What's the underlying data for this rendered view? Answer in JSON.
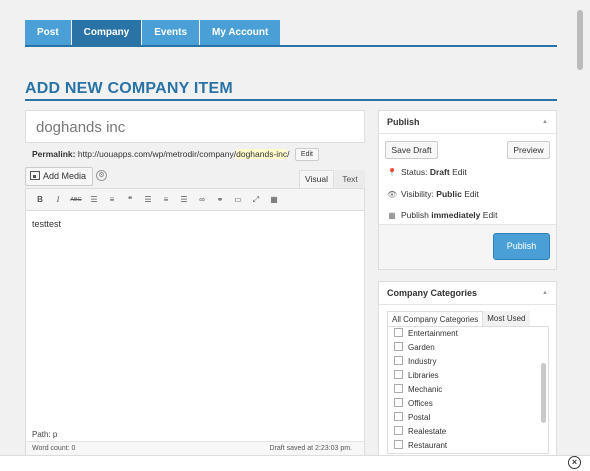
{
  "tabs": [
    {
      "label": "Post",
      "active": false
    },
    {
      "label": "Company",
      "active": true
    },
    {
      "label": "Events",
      "active": false
    },
    {
      "label": "My Account",
      "active": false
    }
  ],
  "page_title": "ADD NEW COMPANY ITEM",
  "editor": {
    "title_value": "doghands inc",
    "permalink_label": "Permalink:",
    "permalink_base": "http://uouapps.com/wp/metrodir/company/",
    "permalink_slug": "doghands-inc",
    "permalink_trailing": "/",
    "edit_label": "Edit",
    "add_media_label": "Add Media",
    "visual_tab": "Visual",
    "text_tab": "Text",
    "toolbar_bold": "B",
    "toolbar_italic": "I",
    "toolbar_strike": "ABC",
    "content": "testtest",
    "path_text": "Path: p",
    "word_count": "Word count: 0",
    "draft_saved": "Draft saved at 2:23:03 pm."
  },
  "publish": {
    "title": "Publish",
    "save_draft": "Save Draft",
    "preview": "Preview",
    "status_label": "Status:",
    "status_value": "Draft",
    "visibility_label": "Visibility:",
    "visibility_value": "Public",
    "publish_label": "Publish",
    "publish_value": "immediately",
    "edit": "Edit",
    "publish_button": "Publish"
  },
  "categories": {
    "title": "Company Categories",
    "tab_all": "All Company Categories",
    "tab_most": "Most Used",
    "items": [
      "Entertainment",
      "Garden",
      "Industry",
      "Libraries",
      "Mechanic",
      "Offices",
      "Postal",
      "Realestate",
      "Restaurant"
    ]
  },
  "colors": {
    "accent": "#2a73a6",
    "tab": "#4aa0d6",
    "publish_button": "#4aa0d6"
  }
}
